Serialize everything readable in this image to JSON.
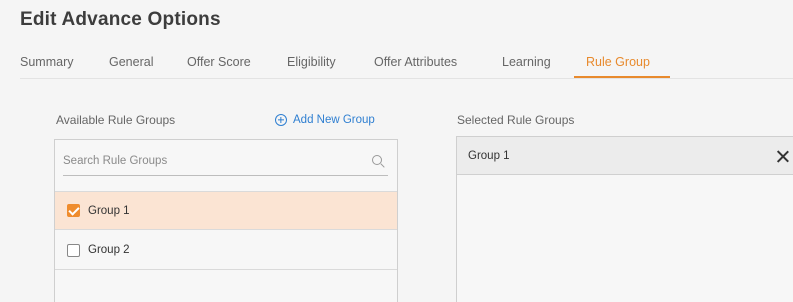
{
  "header": {
    "title": "Edit Advance Options"
  },
  "tabs": [
    {
      "label": "Summary",
      "active": false
    },
    {
      "label": "General",
      "active": false
    },
    {
      "label": "Offer Score",
      "active": false
    },
    {
      "label": "Eligibility",
      "active": false
    },
    {
      "label": "Offer Attributes",
      "active": false
    },
    {
      "label": "Learning",
      "active": false
    },
    {
      "label": "Rule Group",
      "active": true
    }
  ],
  "available": {
    "label": "Available Rule Groups",
    "add_label": "Add New Group",
    "search_placeholder": "Search Rule Groups",
    "items": [
      {
        "label": "Group 1",
        "checked": true
      },
      {
        "label": "Group 2",
        "checked": false
      }
    ]
  },
  "selected": {
    "label": "Selected Rule Groups",
    "items": [
      {
        "label": "Group 1"
      }
    ]
  },
  "colors": {
    "accent": "#e88a2d",
    "link": "#2f7fd1",
    "highlight": "#fbe4d3"
  }
}
